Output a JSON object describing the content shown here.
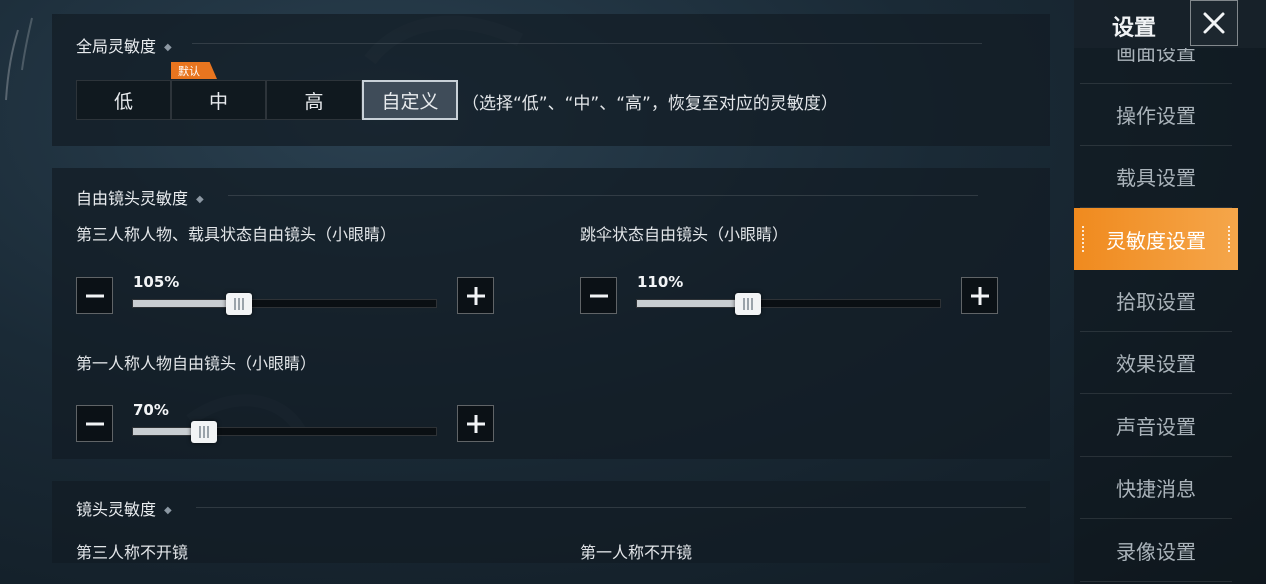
{
  "global": {
    "title": "全局灵敏度",
    "presets": [
      "低",
      "中",
      "高",
      "自定义"
    ],
    "active_preset": "自定义",
    "default_tag": "默认",
    "note": "（选择“低”、“中”、“高”，恢复至对应的灵敏度）"
  },
  "free_camera": {
    "title": "自由镜头灵敏度",
    "sliders": [
      {
        "label": "第三人称人物、载具状态自由镜头（小眼睛）",
        "value_text": "105%",
        "value": 105,
        "max": 300
      },
      {
        "label": "跳伞状态自由镜头（小眼睛）",
        "value_text": "110%",
        "value": 110,
        "max": 300
      },
      {
        "label": "第一人称人物自由镜头（小眼睛）",
        "value_text": "70%",
        "value": 70,
        "max": 300
      }
    ]
  },
  "camera": {
    "title": "镜头灵敏度",
    "left_label": "第三人称不开镜",
    "right_label": "第一人称不开镜"
  },
  "sidebar": {
    "title": "设置",
    "items": [
      "画面设置",
      "操作设置",
      "载具设置",
      "灵敏度设置",
      "拾取设置",
      "效果设置",
      "声音设置",
      "快捷消息",
      "录像设置"
    ],
    "active": "灵敏度设置"
  },
  "colors": {
    "accent": "#f08a1e",
    "panel": "#121c24"
  }
}
